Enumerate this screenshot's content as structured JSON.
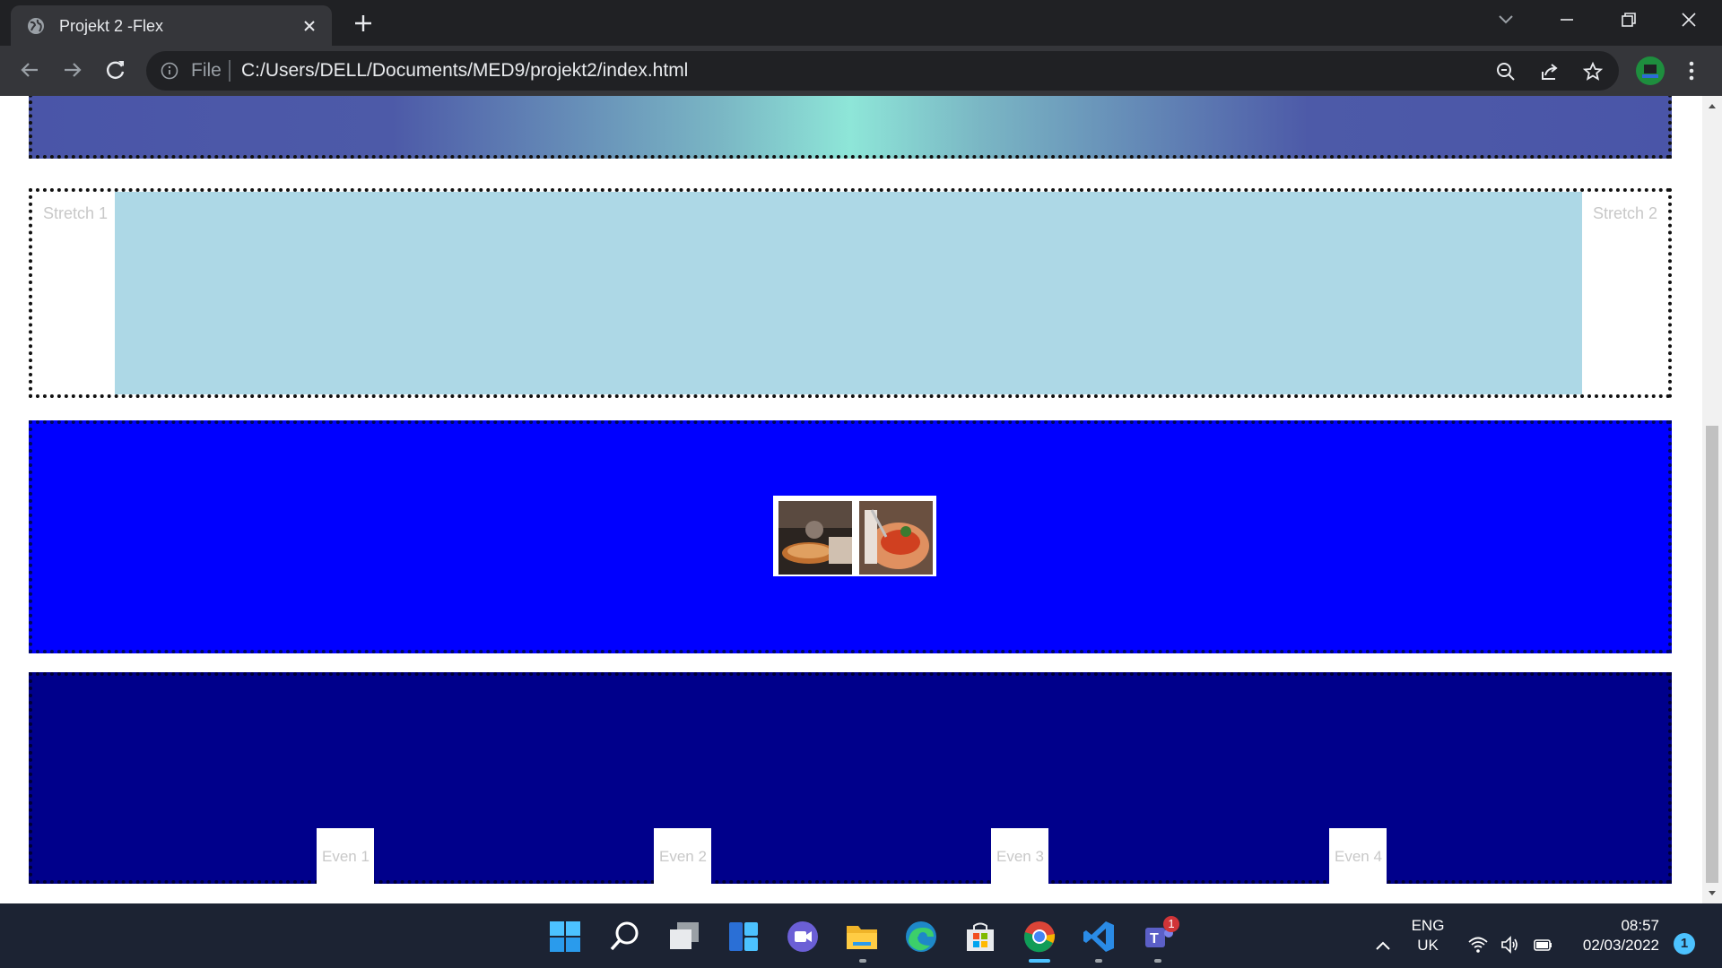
{
  "browser": {
    "tab_title": "Projekt 2 -Flex",
    "omnibox_scheme_label": "File",
    "url": "C:/Users/DELL/Documents/MED9/projekt2/index.html"
  },
  "page": {
    "stretch_items": [
      "Stretch 1",
      "Stretch 2"
    ],
    "even_items": [
      "Even 1",
      "Even 2",
      "Even 3",
      "Even 4"
    ],
    "colors": {
      "stretch_fill": "#add8e6",
      "center_box": "#0000ff",
      "even_box": "#00008b"
    }
  },
  "taskbar": {
    "apps": [
      "start-icon",
      "search-icon",
      "task-view-icon",
      "widgets-icon",
      "chat-icon",
      "file-explorer-icon",
      "edge-icon",
      "store-icon",
      "chrome-icon",
      "vscode-icon",
      "teams-icon"
    ],
    "teams_badge": "1",
    "language_top": "ENG",
    "language_bottom": "UK",
    "time": "08:57",
    "date": "02/03/2022",
    "notification_count": "1"
  }
}
